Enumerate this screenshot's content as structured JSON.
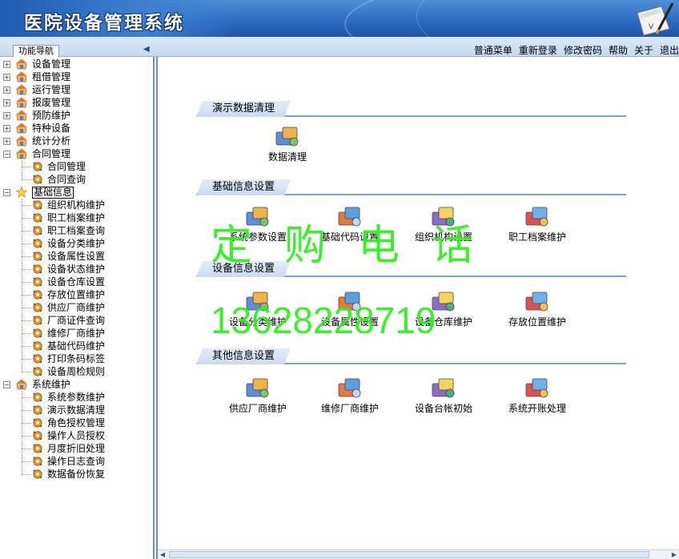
{
  "app": {
    "title": "医院设备管理系统"
  },
  "nav": {
    "tab_label": "功能导航"
  },
  "menu": [
    "普通菜单",
    "重新登录",
    "修改密码",
    "帮助",
    "关于",
    "退出"
  ],
  "tree": [
    {
      "label": "设备管理",
      "expanded": false,
      "icon": "folder-house-icon"
    },
    {
      "label": "租借管理",
      "expanded": false,
      "icon": "folder-house-icon"
    },
    {
      "label": "运行管理",
      "expanded": false,
      "icon": "folder-house-icon"
    },
    {
      "label": "报废管理",
      "expanded": false,
      "icon": "folder-house-icon"
    },
    {
      "label": "预防维护",
      "expanded": false,
      "icon": "folder-house-icon"
    },
    {
      "label": "特种设备",
      "expanded": false,
      "icon": "folder-house-icon"
    },
    {
      "label": "统计分析",
      "expanded": false,
      "icon": "folder-house-icon"
    },
    {
      "label": "合同管理",
      "expanded": true,
      "icon": "folder-house-icon",
      "children": [
        "合同管理",
        "合同查询"
      ]
    },
    {
      "label": "基础信息",
      "expanded": true,
      "selected": true,
      "icon": "star-icon",
      "children": [
        "组织机构维护",
        "职工档案维护",
        "职工档案查询",
        "设备分类维护",
        "设备属性设置",
        "设备状态维护",
        "设备仓库设置",
        "存放位置维护",
        "供应厂商维护",
        "厂商证件查询",
        "维修厂商维护",
        "基础代码维护",
        "打印条码标签",
        "设备周检规则"
      ]
    },
    {
      "label": "系统维护",
      "expanded": true,
      "icon": "folder-house-icon",
      "children": [
        "系统参数维护",
        "演示数据清理",
        "角色授权管理",
        "操作人员授权",
        "月度折旧处理",
        "操作日志查询",
        "数据备份恢复"
      ]
    }
  ],
  "sections": [
    {
      "title": "演示数据清理",
      "items": [
        {
          "label": "数据清理",
          "icon": "data-cleanup-icon"
        }
      ]
    },
    {
      "title": "基础信息设置",
      "items": [
        {
          "label": "系统参数设置",
          "icon": "system-params-icon"
        },
        {
          "label": "基础代码设置",
          "icon": "basic-codes-icon"
        },
        {
          "label": "组织机构设置",
          "icon": "organization-icon"
        },
        {
          "label": "职工档案维护",
          "icon": "staff-records-icon"
        }
      ]
    },
    {
      "title": "设备信息设置",
      "items": [
        {
          "label": "设备分类维护",
          "icon": "equipment-category-icon"
        },
        {
          "label": "设备属性设置",
          "icon": "equipment-attributes-icon"
        },
        {
          "label": "设备仓库维护",
          "icon": "warehouse-icon"
        },
        {
          "label": "存放位置维护",
          "icon": "storage-location-icon"
        }
      ]
    },
    {
      "title": "其他信息设置",
      "items": [
        {
          "label": "供应厂商维护",
          "icon": "supplier-icon"
        },
        {
          "label": "维修厂商维护",
          "icon": "repair-vendor-icon"
        },
        {
          "label": "设备台帐初始",
          "icon": "ledger-init-icon"
        },
        {
          "label": "系统开账处理",
          "icon": "open-account-icon"
        }
      ]
    }
  ],
  "watermark": {
    "line1": "定购电话",
    "line2": "13628228719"
  }
}
